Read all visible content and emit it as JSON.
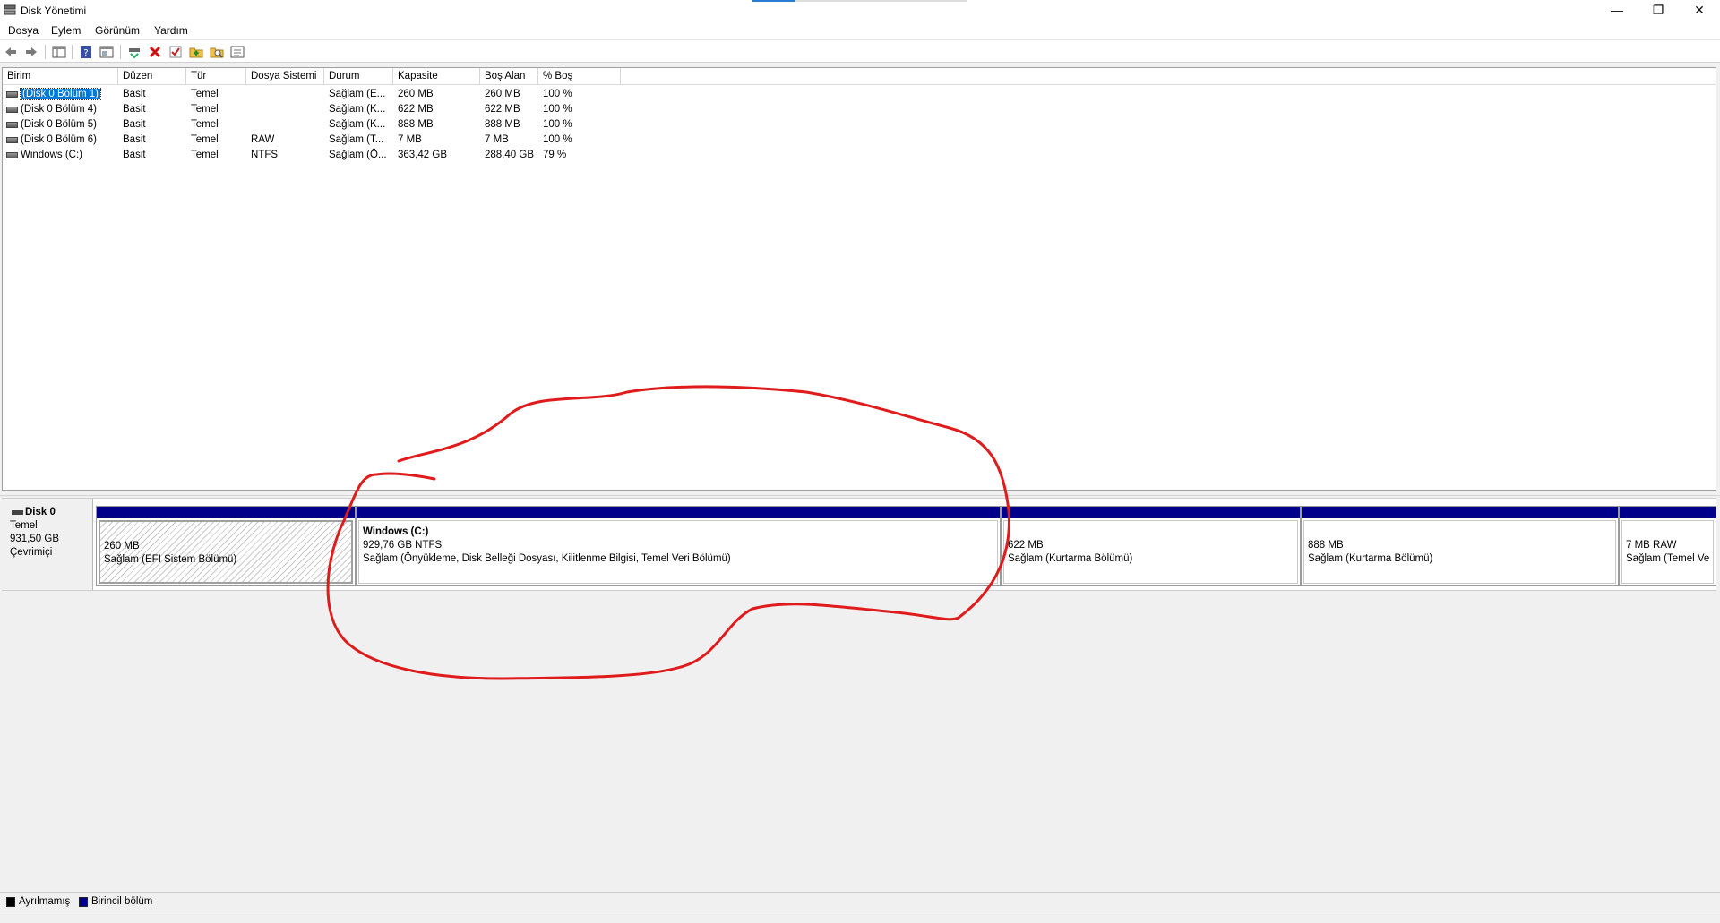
{
  "window": {
    "title": "Disk Yönetimi",
    "minimize": "—",
    "restore": "❐",
    "close": "✕"
  },
  "menu": [
    "Dosya",
    "Eylem",
    "Görünüm",
    "Yardım"
  ],
  "toolbar_icons": [
    "back-arrow-icon",
    "forward-arrow-icon",
    "console-tree-icon",
    "help-icon",
    "properties-icon",
    "connect-icon",
    "delete-icon",
    "check-icon",
    "folder-up-icon",
    "search-folder-icon",
    "view-icon"
  ],
  "columns": [
    "Birim",
    "Düzen",
    "Tür",
    "Dosya Sistemi",
    "Durum",
    "Kapasite",
    "Boş Alan",
    "% Boş"
  ],
  "volumes": [
    {
      "name": "(Disk 0 Bölüm 1)",
      "layout": "Basit",
      "type": "Temel",
      "fs": "",
      "status": "Sağlam (E...",
      "capacity": "260 MB",
      "free": "260 MB",
      "pct": "100 %"
    },
    {
      "name": "(Disk 0 Bölüm 4)",
      "layout": "Basit",
      "type": "Temel",
      "fs": "",
      "status": "Sağlam (K...",
      "capacity": "622 MB",
      "free": "622 MB",
      "pct": "100 %"
    },
    {
      "name": "(Disk 0 Bölüm 5)",
      "layout": "Basit",
      "type": "Temel",
      "fs": "",
      "status": "Sağlam (K...",
      "capacity": "888 MB",
      "free": "888 MB",
      "pct": "100 %"
    },
    {
      "name": "(Disk 0 Bölüm 6)",
      "layout": "Basit",
      "type": "Temel",
      "fs": "RAW",
      "status": "Sağlam (T...",
      "capacity": "7 MB",
      "free": "7 MB",
      "pct": "100 %"
    },
    {
      "name": "Windows (C:)",
      "layout": "Basit",
      "type": "Temel",
      "fs": "NTFS",
      "status": "Sağlam (Ö...",
      "capacity": "363,42 GB",
      "free": "288,40 GB",
      "pct": "79 %"
    }
  ],
  "disk": {
    "name": "Disk 0",
    "type": "Temel",
    "size": "931,50 GB",
    "state": "Çevrimiçi",
    "partitions": [
      {
        "title": "",
        "line1": "260 MB",
        "line2": "Sağlam (EFI Sistem Bölümü)"
      },
      {
        "title": "Windows  (C:)",
        "line1": "929,76 GB NTFS",
        "line2": "Sağlam (Önyükleme, Disk Belleği Dosyası, Kilitlenme Bilgisi, Temel Veri Bölümü)"
      },
      {
        "title": "",
        "line1": "622 MB",
        "line2": "Sağlam (Kurtarma Bölümü)"
      },
      {
        "title": "",
        "line1": "888 MB",
        "line2": "Sağlam (Kurtarma Bölümü)"
      },
      {
        "title": "",
        "line1": "7 MB RAW",
        "line2": "Sağlam (Temel Ve"
      }
    ]
  },
  "legend": [
    {
      "label": "Ayrılmamış",
      "color": "#000000"
    },
    {
      "label": "Birincil bölüm",
      "color": "#00008b"
    }
  ],
  "colors": {
    "partition_bar": "#00008b",
    "selection": "#0078d7",
    "annotation": "#e01b1b"
  }
}
